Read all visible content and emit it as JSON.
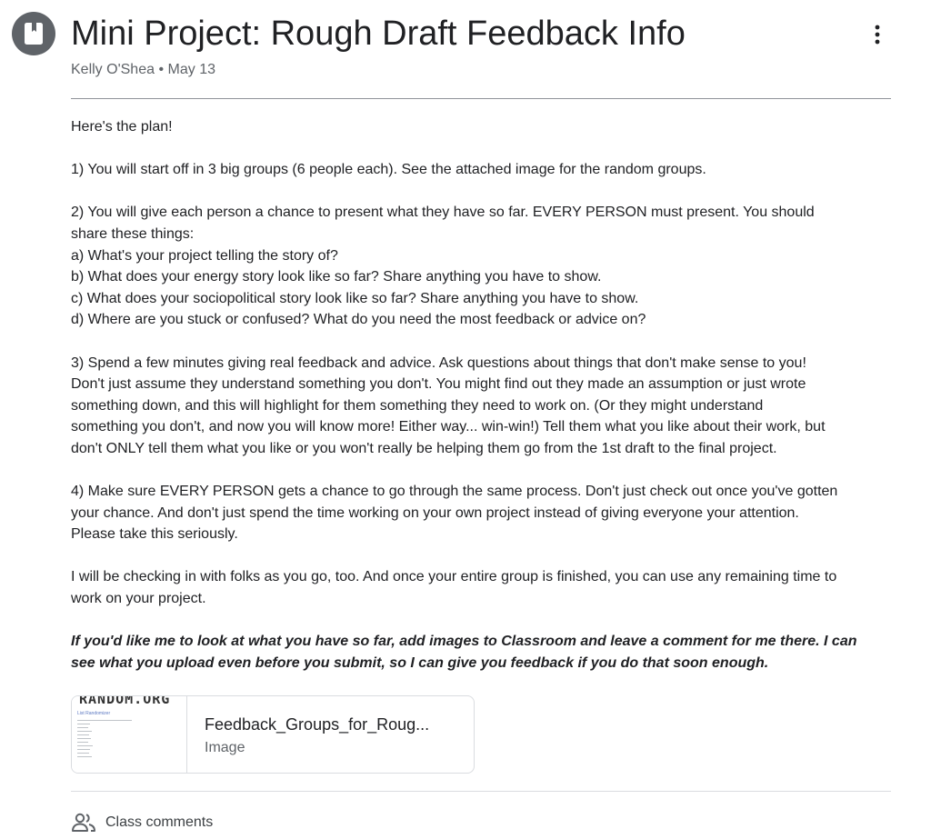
{
  "header": {
    "title": "Mini Project: Rough Draft Feedback Info",
    "author": "Kelly O'Shea",
    "separator": "•",
    "date": "May 13",
    "icon": "assignment-book-icon",
    "menu_icon": "more-vert-icon"
  },
  "body": {
    "intro": "Here's the plan!",
    "step1": "1) You will start off in 3 big groups (6 people each). See the attached image for the random groups.",
    "step2_lines": [
      "2) You will give each person a chance to present what they have so far. EVERY PERSON must present. You should",
      "share these things:",
      "a) What's your project telling the story of?",
      "b) What does your energy story look like so far? Share anything you have to show.",
      "c) What does your sociopolitical story look like so far? Share anything you have to show.",
      "d) Where are you stuck or confused? What do you need the most feedback or advice on?"
    ],
    "step3_lines": [
      "3) Spend a few minutes giving real feedback and advice. Ask questions about things that don't make sense to you!",
      "Don't just assume they understand something you don't. You might find out they made an assumption or just wrote",
      "something down, and this will highlight for them something they need to work on. (Or they might understand",
      "something you don't, and now you will know more! Either way... win-win!) Tell them what you like about their work, but",
      "don't ONLY tell them what you like or you won't really be helping them go from the 1st draft to the final project."
    ],
    "step4_lines": [
      "4) Make sure EVERY PERSON gets a chance to go through the same process. Don't just check out once you've gotten",
      "your chance. And don't just spend the time working on your own project instead of giving everyone your attention.",
      "Please take this seriously."
    ],
    "closing_lines": [
      "I will be checking in with folks as you go, too. And once your entire group is finished, you can use any remaining time to",
      "work on your project."
    ],
    "note_lines": [
      "If you'd like me to look at what you have so far, add images to Classroom and leave a comment for me there. I can",
      "see what you upload even before you submit, so I can give you feedback if you do that soon enough."
    ]
  },
  "attachment": {
    "name": "Feedback_Groups_for_Roug...",
    "type": "Image",
    "thumb_logo": "RANDOM.ORG",
    "thumb_subtitle": "List Randomizer"
  },
  "comments": {
    "icon": "people-icon",
    "label": "Class comments"
  },
  "colors": {
    "title": "#202124",
    "meta": "#5f6368",
    "icon_bg": "#5f6368",
    "border": "#dadce0"
  }
}
